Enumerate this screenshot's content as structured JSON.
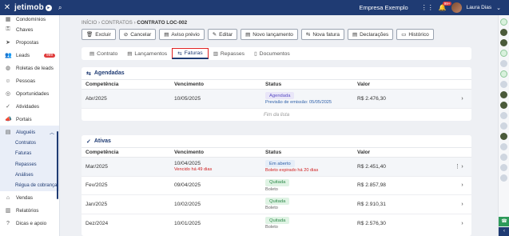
{
  "topbar": {
    "close_icon": "close-icon",
    "logo": "jetimob",
    "company": "Empresa Exemplo",
    "notifications_badge": "99+",
    "user": "Laura Dias"
  },
  "sidebar": {
    "items": [
      {
        "icon": "building-icon",
        "label": "Condomínios"
      },
      {
        "icon": "key-icon",
        "label": "Chaves"
      },
      {
        "icon": "paper-plane-icon",
        "label": "Propostas"
      },
      {
        "icon": "users-icon",
        "label": "Leads",
        "count": "999"
      },
      {
        "icon": "roulette-icon",
        "label": "Roletas de leads"
      },
      {
        "icon": "people-icon",
        "label": "Pessoas"
      },
      {
        "icon": "target-icon",
        "label": "Oportunidades"
      },
      {
        "icon": "check-circle-icon",
        "label": "Atividades"
      },
      {
        "icon": "megaphone-icon",
        "label": "Portais"
      },
      {
        "icon": "document-icon",
        "label": "Aluguéis"
      }
    ],
    "sub_items": [
      "Contratos",
      "Faturas",
      "Repasses",
      "Análises",
      "Régua de cobrança"
    ],
    "bottom_items": [
      {
        "icon": "sales-icon",
        "label": "Vendas"
      },
      {
        "icon": "reports-icon",
        "label": "Relatórios"
      },
      {
        "icon": "help-icon",
        "label": "Dicas e apoio"
      }
    ]
  },
  "breadcrumb": {
    "home": "INÍCIO",
    "section": "CONTRATOS",
    "current": "CONTRATO LOC-002"
  },
  "actions": [
    "Excluir",
    "Cancelar",
    "Aviso prévio",
    "Editar",
    "Novo lançamento",
    "Nova fatura",
    "Declarações",
    "Histórico"
  ],
  "tabs": [
    "Contrato",
    "Lançamentos",
    "Faturas",
    "Repasses",
    "Documentos"
  ],
  "columns": [
    "Competência",
    "Vencimento",
    "Status",
    "Valor"
  ],
  "scheduled": {
    "title": "Agendadas",
    "rows": [
      {
        "competencia": "Abr/2025",
        "vencimento": "10/05/2025",
        "status": "Agendada",
        "note": "Previsão de emissão: 05/05/2025",
        "valor": "R$ 2.476,30"
      }
    ],
    "end_text": "Fim da lista"
  },
  "active": {
    "title": "Ativas",
    "rows": [
      {
        "competencia": "Mar/2025",
        "vencimento": "10/04/2025",
        "venc_note": "Vencido há 49 dias",
        "status": "Em aberto",
        "note": "Boleto expirado há 20 dias",
        "valor": "R$ 2.451,40"
      },
      {
        "competencia": "Fev/2025",
        "vencimento": "09/04/2025",
        "status": "Quitada",
        "note": "Boleto",
        "valor": "R$ 2.857,98"
      },
      {
        "competencia": "Jan/2025",
        "vencimento": "10/02/2025",
        "status": "Quitada",
        "note": "Boleto",
        "valor": "R$ 2.910,31"
      },
      {
        "competencia": "Dez/2024",
        "vencimento": "10/01/2025",
        "status": "Quitada",
        "note": "Boleto",
        "valor": "R$ 2.576,30"
      }
    ]
  }
}
